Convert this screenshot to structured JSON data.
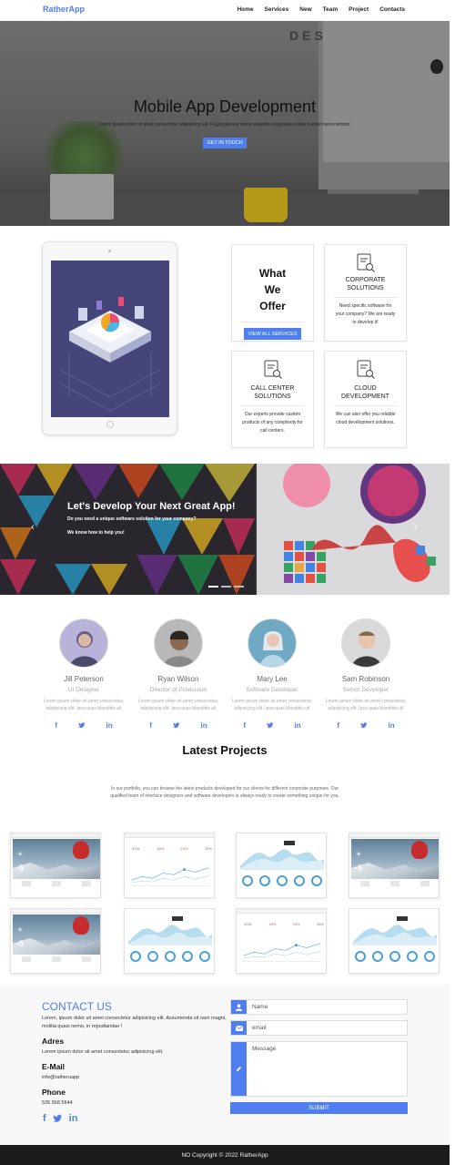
{
  "nav": {
    "brand": "RatherApp",
    "items": [
      "Home",
      "Services",
      "New",
      "Team",
      "Project",
      "Contacts"
    ]
  },
  "hero": {
    "background_word": "DES",
    "title": "Mobile App Development",
    "subtitle": "Lorem ipsum dolor sit amet consectetur adipisicing elit. Fugiat placeat nemo expedita voluptates neque eveniet nemo tempor.",
    "button": "GET IN TOUCH"
  },
  "services": {
    "heading": "What We Offer",
    "button": "VIEW ALL SERVICES",
    "cards": [
      {
        "icon": "document-search-icon",
        "title": "CORPORATE SOLUTIONS",
        "desc": "Need specific software for your company? We are ready to develop it!"
      },
      {
        "icon": "document-search-icon",
        "title": "CALL CENTER SOLUTIONS",
        "desc": "Our experts provide custom products of any complexity for call centers."
      },
      {
        "icon": "document-search-icon",
        "title": "CLOUD DEVELOPMENT",
        "desc": "We can also offer you reliable cloud development solutions."
      }
    ]
  },
  "carousel": {
    "title": "Let's Develop Your Next Great App!",
    "subtitle": "Do you need a unique software solution for your company?",
    "subtitle2": "We know how to help you!",
    "prev": "‹",
    "next": "›"
  },
  "team": [
    {
      "name": "Jill Peterson",
      "role": "UI Designer",
      "bio": "Lorem ipsum dolor sit amet consectetur, adipisicing elit. Ipsa quas blanditiis ut!"
    },
    {
      "name": "Ryan Wilson",
      "role": "Director of Production",
      "bio": "Lorem ipsum dolor sit amet consectetur, adipisicing elit. Ipsa quas blanditiis ut!"
    },
    {
      "name": "Mary Lee",
      "role": "Software Developer",
      "bio": "Lorem ipsum dolor sit amet consectetur, adipisicing elit. Ipsa quas blanditiis ut!"
    },
    {
      "name": "Sam Robinson",
      "role": "Senior Developer",
      "bio": "Lorem ipsum dolor sit amet consectetur, adipisicing elit. Ipsa quas blanditiis ut!"
    }
  ],
  "social_icons": {
    "facebook": "f",
    "twitter": "t",
    "linkedin": "in"
  },
  "projects": {
    "title": "Latest Projects",
    "subtitle": "In our portfolio, you can browse the latest products developed for our clients for different corporate purposes. Our qualified team of interface designers and software developers is always ready to create something unique for you.",
    "weather_temp": "-5",
    "kpis": [
      "4761",
      "18%",
      "24%",
      "33%"
    ]
  },
  "contact": {
    "title": "CONTACT US",
    "text": "Lorem, ipsum dolor sit amet consectetur adipisicing elit. Assumenda sit nam magni, molitia quasi nemo, in repudiandae !",
    "address_label": "Adres",
    "address": "Lorem ipsum dolor sit amet consectetur adipisicing elit.",
    "email_label": "E-Mail",
    "email": "info@ratheruapp",
    "phone_label": "Phone",
    "phone": "535 568 5644",
    "form": {
      "name_placeholder": "Name",
      "email_placeholder": "email",
      "message_placeholder": "Message",
      "submit": "SUBMIT"
    }
  },
  "footer": {
    "text": "NO Copyright © 2022 RatherApp"
  },
  "colors": {
    "accent": "#4f7ef0",
    "footer": "#1b1b1b"
  }
}
